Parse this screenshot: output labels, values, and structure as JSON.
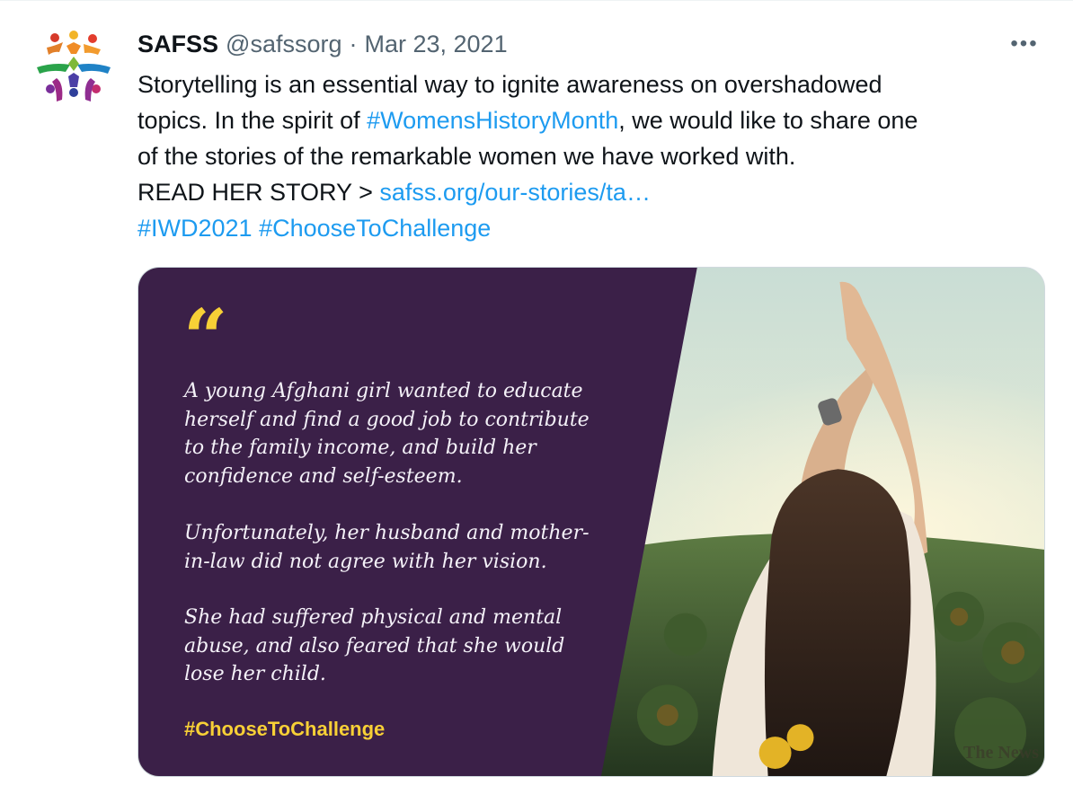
{
  "tweet": {
    "author_name": "SAFSS",
    "handle": "@safssorg",
    "separator": "·",
    "date": "Mar 23, 2021",
    "more_label": "•••",
    "body": {
      "line1": "Storytelling is an essential way to ignite awareness on overshadowed",
      "line2_prefix": "topics. In the spirit of ",
      "line2_hashtag": "#WomensHistoryMonth",
      "line2_suffix": ", we would like to share one",
      "line3": "of the stories of the remarkable women we have worked with.",
      "line4_prefix": "READ HER STORY > ",
      "line4_link": "safss.org/our-stories/ta…",
      "hashtag_1": "#IWD2021",
      "hashtag_2": "#ChooseToChallenge"
    }
  },
  "media": {
    "quote_mark": "“",
    "paragraph1": [
      "A young Afghani girl wanted to educate",
      "herself and find a good job to contribute",
      "to the family income, and build her",
      "confidence and self-esteem."
    ],
    "paragraph2": [
      "Unfortunately, her husband and mother-",
      "in-law did not agree with her vision."
    ],
    "paragraph3": [
      "She had suffered physical and mental",
      "abuse, and also feared that she would",
      "lose her child."
    ],
    "hashtag": "#ChooseToChallenge",
    "watermark": "The News"
  },
  "colors": {
    "link": "#1d9bf0",
    "panel": "#3b2048",
    "accent_yellow": "#f7d036",
    "secondary_text": "#536471"
  },
  "icons": {
    "avatar": "safss-logo",
    "more": "more-horizontal-icon"
  }
}
